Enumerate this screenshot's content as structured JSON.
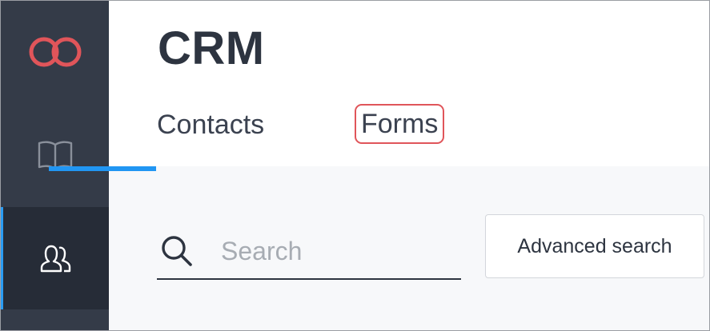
{
  "app": {
    "title": "CRM"
  },
  "sidebar": {
    "items": [
      {
        "name": "logo",
        "icon": "infinity-logo-icon"
      },
      {
        "name": "knowledge-base",
        "icon": "open-book-icon"
      },
      {
        "name": "contacts",
        "icon": "users-icon",
        "active": true
      }
    ],
    "accent_color": "#e0555a",
    "active_indicator_color": "#2b9cf2"
  },
  "tabs": [
    {
      "label": "Contacts",
      "active": true
    },
    {
      "label": "Forms",
      "highlighted": true
    }
  ],
  "search": {
    "placeholder": "Search",
    "value": ""
  },
  "toolbar": {
    "advanced_search_label": "Advanced search"
  }
}
